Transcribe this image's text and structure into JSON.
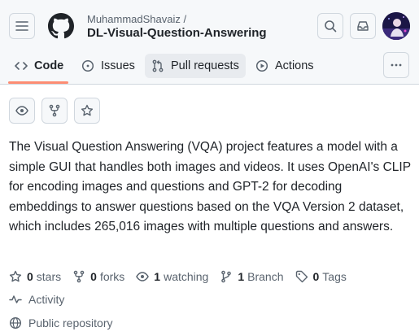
{
  "header": {
    "owner": "MuhammadShavaiz /",
    "repo": "DL-Visual-Question-Answering"
  },
  "tabs": [
    {
      "label": "Code",
      "icon": "code-icon"
    },
    {
      "label": "Issues",
      "icon": "issue-opened-icon"
    },
    {
      "label": "Pull requests",
      "icon": "git-pull-request-icon"
    },
    {
      "label": "Actions",
      "icon": "play-icon"
    }
  ],
  "description": "The Visual Question Answering (VQA) project features a model with a simple GUI that handles both images and videos. It uses OpenAI's CLIP for encoding images and questions and GPT-2 for decoding embeddings to answer questions based on the VQA Version 2 dataset, which includes 265,016 images with multiple questions and answers.",
  "stats": {
    "stars_count": "0",
    "stars_label": "stars",
    "forks_count": "0",
    "forks_label": "forks",
    "watching_count": "1",
    "watching_label": "watching",
    "branch_count": "1",
    "branch_label": "Branch",
    "tags_count": "0",
    "tags_label": "Tags"
  },
  "meta": {
    "activity": "Activity",
    "visibility": "Public repository"
  },
  "colors": {
    "accent_underline": "#fd8c73",
    "text": "#1f2328",
    "muted": "#59636e",
    "border": "#d0d7de"
  }
}
